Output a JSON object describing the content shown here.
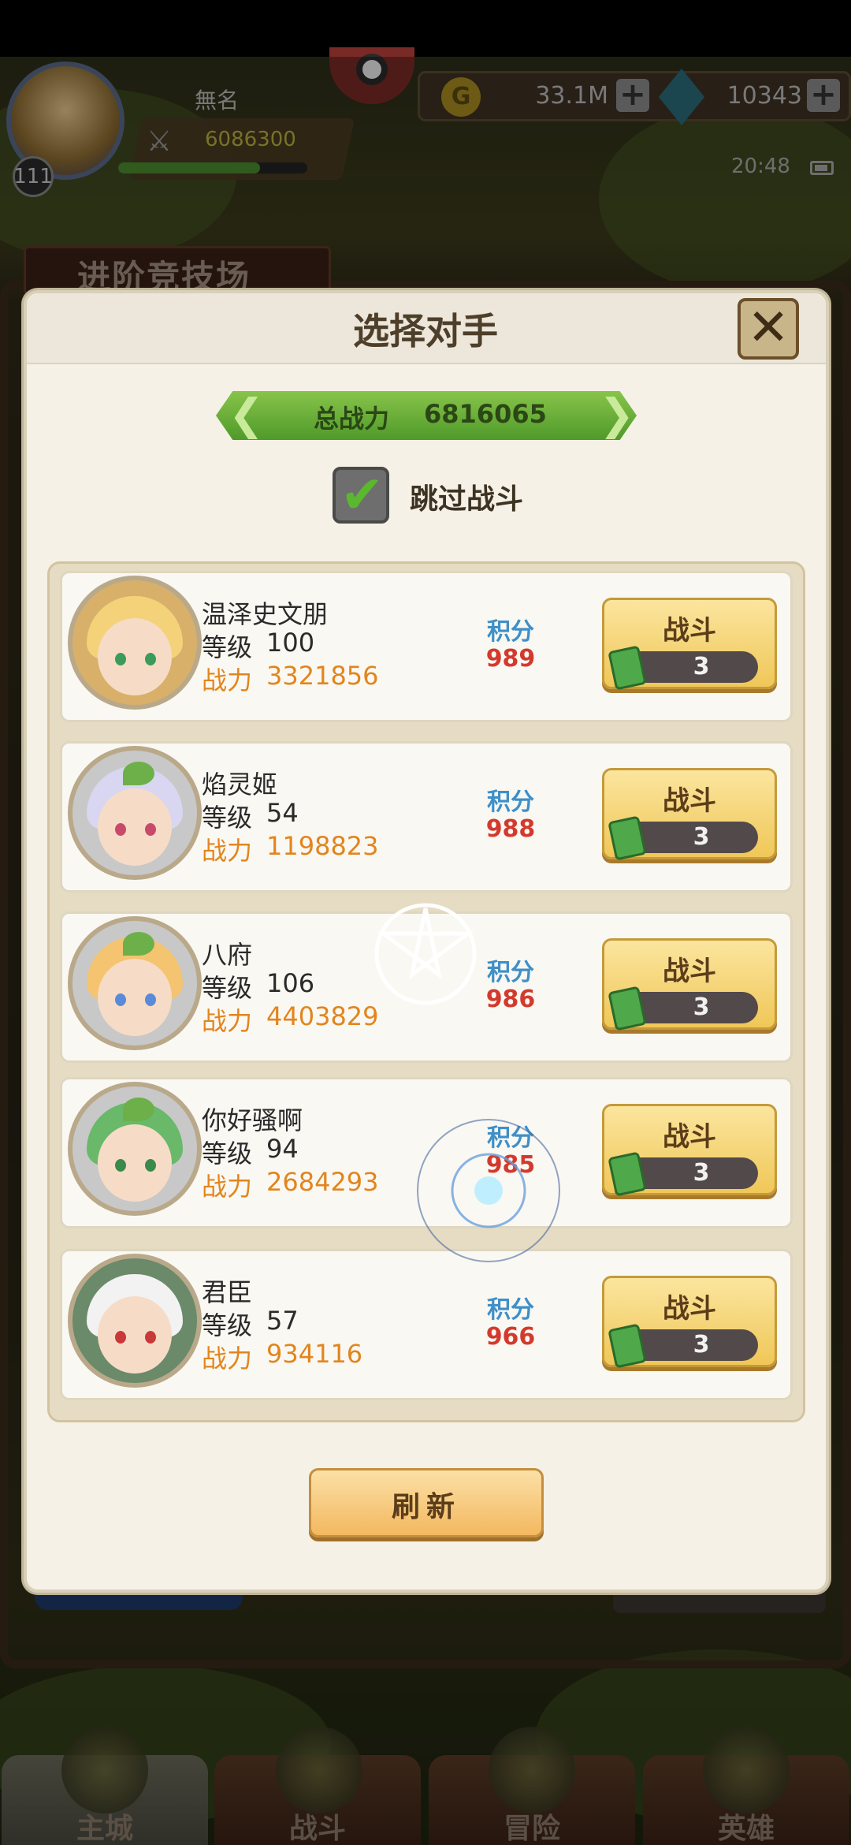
{
  "hud": {
    "player_name": "無名",
    "player_level": "111",
    "player_power": "6086300",
    "exp_fraction": 0.75,
    "gold": "33.1M",
    "gems": "10343",
    "time": "20:48"
  },
  "arena": {
    "title": "进阶竞技场"
  },
  "modal": {
    "title": "选择对手",
    "close_icon": "close-icon",
    "total_power_label": "总战力",
    "total_power_value": "6816065",
    "skip_battle_label": "跳过战斗",
    "skip_battle_checked": true,
    "refresh_label": "刷新"
  },
  "opponents": [
    {
      "name": "温泽史文朋",
      "level_label": "等级",
      "level": "100",
      "power_label": "战力",
      "power": "3321856",
      "score_label": "积分",
      "score": "989",
      "fight_label": "战斗",
      "tickets": "3",
      "hair_color": "#f4d27a"
    },
    {
      "name": "焰灵姬",
      "level_label": "等级",
      "level": "54",
      "power_label": "战力",
      "power": "1198823",
      "score_label": "积分",
      "score": "988",
      "fight_label": "战斗",
      "tickets": "3",
      "hair_color": "#d8d6f0"
    },
    {
      "name": "八府",
      "level_label": "等级",
      "level": "106",
      "power_label": "战力",
      "power": "4403829",
      "score_label": "积分",
      "score": "986",
      "fight_label": "战斗",
      "tickets": "3",
      "hair_color": "#f4c470"
    },
    {
      "name": "你好骚啊",
      "level_label": "等级",
      "level": "94",
      "power_label": "战力",
      "power": "2684293",
      "score_label": "积分",
      "score": "985",
      "fight_label": "战斗",
      "tickets": "3",
      "hair_color": "#6ab86a"
    },
    {
      "name": "君臣",
      "level_label": "等级",
      "level": "57",
      "power_label": "战力",
      "power": "934116",
      "score_label": "积分",
      "score": "966",
      "fight_label": "战斗",
      "tickets": "3",
      "hair_color": "#f2f2f2"
    }
  ],
  "bottom_nav": [
    {
      "label": "主城",
      "icon": "castle-icon",
      "active": true
    },
    {
      "label": "战斗",
      "icon": "crossed-swords-icon",
      "active": false
    },
    {
      "label": "冒险",
      "icon": "map-icon",
      "active": false
    },
    {
      "label": "英雄",
      "icon": "hero-crest-icon",
      "active": false
    }
  ]
}
